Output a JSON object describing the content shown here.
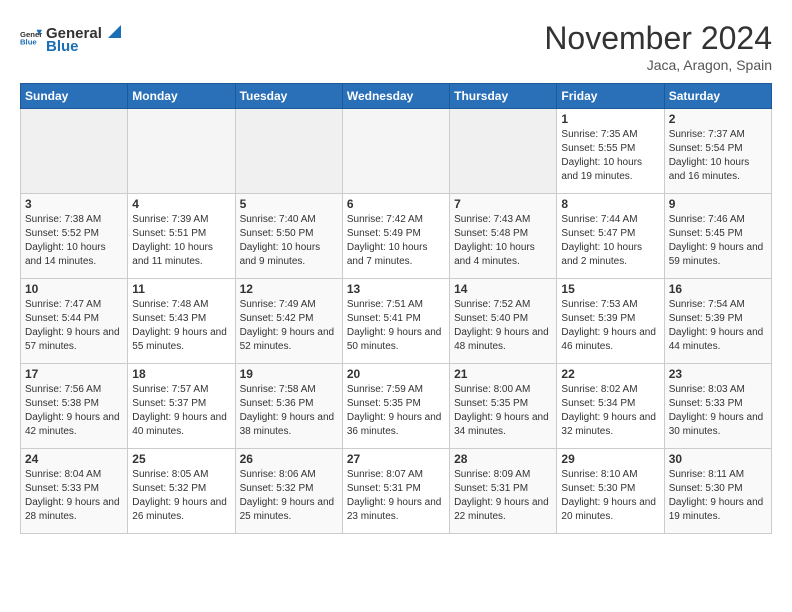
{
  "header": {
    "logo_general": "General",
    "logo_blue": "Blue",
    "title": "November 2024",
    "location": "Jaca, Aragon, Spain"
  },
  "days_of_week": [
    "Sunday",
    "Monday",
    "Tuesday",
    "Wednesday",
    "Thursday",
    "Friday",
    "Saturday"
  ],
  "weeks": [
    [
      {
        "day": "",
        "info": ""
      },
      {
        "day": "",
        "info": ""
      },
      {
        "day": "",
        "info": ""
      },
      {
        "day": "",
        "info": ""
      },
      {
        "day": "",
        "info": ""
      },
      {
        "day": "1",
        "info": "Sunrise: 7:35 AM\nSunset: 5:55 PM\nDaylight: 10 hours and 19 minutes."
      },
      {
        "day": "2",
        "info": "Sunrise: 7:37 AM\nSunset: 5:54 PM\nDaylight: 10 hours and 16 minutes."
      }
    ],
    [
      {
        "day": "3",
        "info": "Sunrise: 7:38 AM\nSunset: 5:52 PM\nDaylight: 10 hours and 14 minutes."
      },
      {
        "day": "4",
        "info": "Sunrise: 7:39 AM\nSunset: 5:51 PM\nDaylight: 10 hours and 11 minutes."
      },
      {
        "day": "5",
        "info": "Sunrise: 7:40 AM\nSunset: 5:50 PM\nDaylight: 10 hours and 9 minutes."
      },
      {
        "day": "6",
        "info": "Sunrise: 7:42 AM\nSunset: 5:49 PM\nDaylight: 10 hours and 7 minutes."
      },
      {
        "day": "7",
        "info": "Sunrise: 7:43 AM\nSunset: 5:48 PM\nDaylight: 10 hours and 4 minutes."
      },
      {
        "day": "8",
        "info": "Sunrise: 7:44 AM\nSunset: 5:47 PM\nDaylight: 10 hours and 2 minutes."
      },
      {
        "day": "9",
        "info": "Sunrise: 7:46 AM\nSunset: 5:45 PM\nDaylight: 9 hours and 59 minutes."
      }
    ],
    [
      {
        "day": "10",
        "info": "Sunrise: 7:47 AM\nSunset: 5:44 PM\nDaylight: 9 hours and 57 minutes."
      },
      {
        "day": "11",
        "info": "Sunrise: 7:48 AM\nSunset: 5:43 PM\nDaylight: 9 hours and 55 minutes."
      },
      {
        "day": "12",
        "info": "Sunrise: 7:49 AM\nSunset: 5:42 PM\nDaylight: 9 hours and 52 minutes."
      },
      {
        "day": "13",
        "info": "Sunrise: 7:51 AM\nSunset: 5:41 PM\nDaylight: 9 hours and 50 minutes."
      },
      {
        "day": "14",
        "info": "Sunrise: 7:52 AM\nSunset: 5:40 PM\nDaylight: 9 hours and 48 minutes."
      },
      {
        "day": "15",
        "info": "Sunrise: 7:53 AM\nSunset: 5:39 PM\nDaylight: 9 hours and 46 minutes."
      },
      {
        "day": "16",
        "info": "Sunrise: 7:54 AM\nSunset: 5:39 PM\nDaylight: 9 hours and 44 minutes."
      }
    ],
    [
      {
        "day": "17",
        "info": "Sunrise: 7:56 AM\nSunset: 5:38 PM\nDaylight: 9 hours and 42 minutes."
      },
      {
        "day": "18",
        "info": "Sunrise: 7:57 AM\nSunset: 5:37 PM\nDaylight: 9 hours and 40 minutes."
      },
      {
        "day": "19",
        "info": "Sunrise: 7:58 AM\nSunset: 5:36 PM\nDaylight: 9 hours and 38 minutes."
      },
      {
        "day": "20",
        "info": "Sunrise: 7:59 AM\nSunset: 5:35 PM\nDaylight: 9 hours and 36 minutes."
      },
      {
        "day": "21",
        "info": "Sunrise: 8:00 AM\nSunset: 5:35 PM\nDaylight: 9 hours and 34 minutes."
      },
      {
        "day": "22",
        "info": "Sunrise: 8:02 AM\nSunset: 5:34 PM\nDaylight: 9 hours and 32 minutes."
      },
      {
        "day": "23",
        "info": "Sunrise: 8:03 AM\nSunset: 5:33 PM\nDaylight: 9 hours and 30 minutes."
      }
    ],
    [
      {
        "day": "24",
        "info": "Sunrise: 8:04 AM\nSunset: 5:33 PM\nDaylight: 9 hours and 28 minutes."
      },
      {
        "day": "25",
        "info": "Sunrise: 8:05 AM\nSunset: 5:32 PM\nDaylight: 9 hours and 26 minutes."
      },
      {
        "day": "26",
        "info": "Sunrise: 8:06 AM\nSunset: 5:32 PM\nDaylight: 9 hours and 25 minutes."
      },
      {
        "day": "27",
        "info": "Sunrise: 8:07 AM\nSunset: 5:31 PM\nDaylight: 9 hours and 23 minutes."
      },
      {
        "day": "28",
        "info": "Sunrise: 8:09 AM\nSunset: 5:31 PM\nDaylight: 9 hours and 22 minutes."
      },
      {
        "day": "29",
        "info": "Sunrise: 8:10 AM\nSunset: 5:30 PM\nDaylight: 9 hours and 20 minutes."
      },
      {
        "day": "30",
        "info": "Sunrise: 8:11 AM\nSunset: 5:30 PM\nDaylight: 9 hours and 19 minutes."
      }
    ]
  ]
}
